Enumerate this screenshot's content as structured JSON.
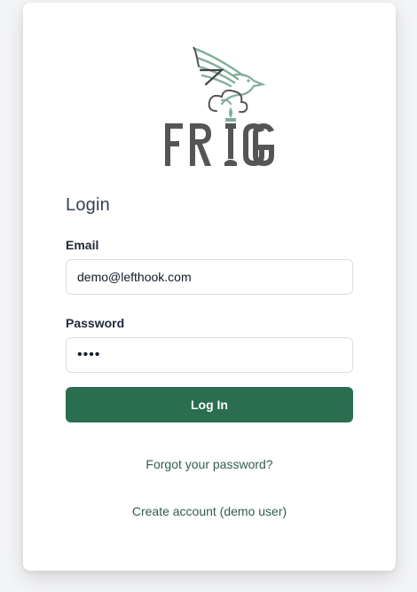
{
  "brand": {
    "logo_text": "FRIGG",
    "accent_color": "#2a6e4f",
    "logo_green": "#7fae98",
    "logo_gray": "#555555"
  },
  "login": {
    "title": "Login",
    "email_label": "Email",
    "email_value": "demo@lefthook.com",
    "password_label": "Password",
    "password_value": "demo",
    "submit_label": "Log In",
    "forgot_link": "Forgot your password?",
    "create_link": "Create account (demo user)"
  }
}
